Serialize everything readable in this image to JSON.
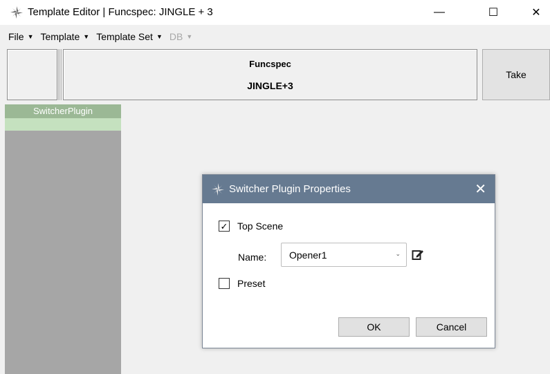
{
  "window": {
    "title": "Template Editor | Funcspec: JINGLE + 3",
    "app_icon": "gear-flower-icon",
    "minimize_glyph": "—",
    "maximize_glyph": "☐",
    "close_glyph": "✕"
  },
  "menu": {
    "items": [
      {
        "label": "File",
        "enabled": true
      },
      {
        "label": "Template",
        "enabled": true
      },
      {
        "label": "Template Set",
        "enabled": true
      },
      {
        "label": "DB",
        "enabled": false
      }
    ],
    "caret": "▼"
  },
  "header": {
    "title": "Funcspec",
    "subtitle": "JINGLE+3",
    "take_label": "Take"
  },
  "plugins": {
    "header": "SwitcherPlugin"
  },
  "dialog": {
    "title": "Switcher Plugin Properties",
    "close_glyph": "✕",
    "top_scene": {
      "label": "Top Scene",
      "checked": true,
      "check_glyph": "✓"
    },
    "name": {
      "label": "Name:",
      "value": "Opener1",
      "caret": "⌄"
    },
    "preset": {
      "label": "Preset",
      "checked": false
    },
    "ok_label": "OK",
    "cancel_label": "Cancel"
  },
  "colors": {
    "dialog_titlebar": "#667a91",
    "plugin_header": "#9bb895",
    "plugin_row": "#c5e1bf",
    "plugin_column": "#a6a6a6"
  }
}
